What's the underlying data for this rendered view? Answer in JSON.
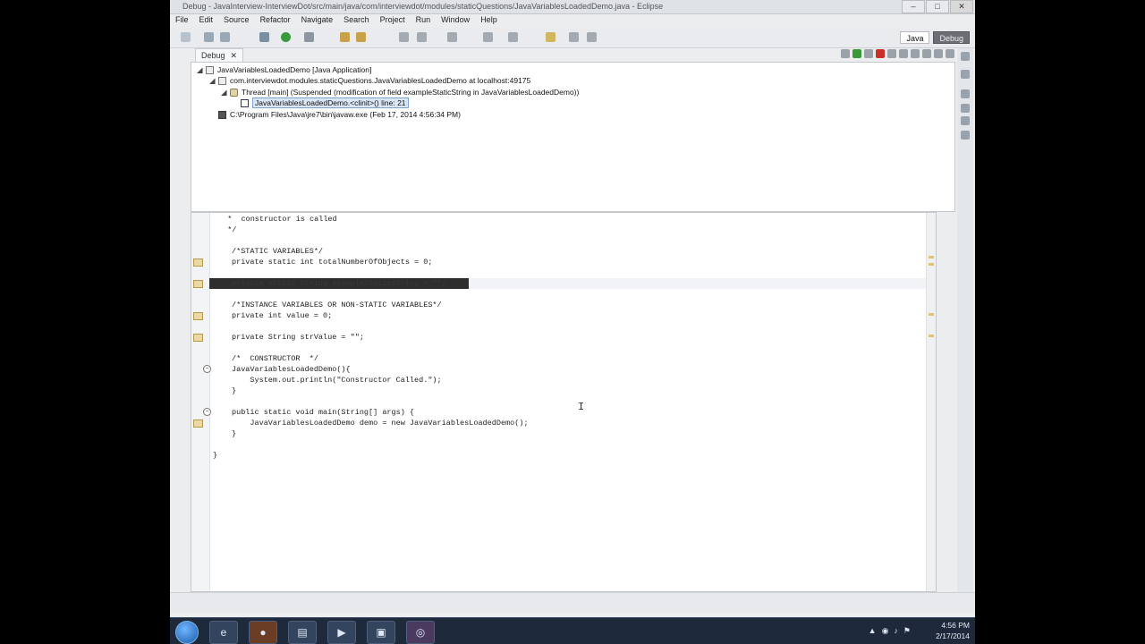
{
  "window": {
    "title": "Debug - JavaInterview-InterviewDot/src/main/java/com/interviewdot/modules/staticQuestions/JavaVariablesLoadedDemo.java - Eclipse",
    "controls": [
      "–",
      "□",
      "✕"
    ]
  },
  "menu": [
    "File",
    "Edit",
    "Source",
    "Refactor",
    "Navigate",
    "Search",
    "Project",
    "Run",
    "Window",
    "Help"
  ],
  "toolbar": {
    "perspective_java": "Java",
    "perspective_debug": "Debug"
  },
  "debug_view": {
    "tab_label": "Debug",
    "tab_close": "✕",
    "tree": [
      {
        "text": "JavaVariablesLoadedDemo [Java Application]",
        "icon": "app-launch-icon"
      },
      {
        "text": "com.interviewdot.modules.staticQuestions.JavaVariablesLoadedDemo at localhost:49175",
        "icon": "vm-icon"
      },
      {
        "text": "Thread [main] (Suspended (modification of field exampleStaticString in JavaVariablesLoadedDemo))",
        "icon": "thread-icon"
      },
      {
        "text": "JavaVariablesLoadedDemo.<clinit>() line: 21",
        "icon": "stack-frame-icon"
      },
      {
        "text": "C:\\Program Files\\Java\\jre7\\bin\\javaw.exe (Feb 17, 2014 4:56:34 PM)",
        "icon": "process-icon"
      }
    ]
  },
  "editor": {
    "lines": [
      {
        "text": "  *  constructor is called"
      },
      {
        "text": "  */"
      },
      {
        "text": ""
      },
      {
        "text": "/*STATIC VARIABLES*/"
      },
      {
        "text": "private static int totalNumberOfObjects = 0;"
      },
      {
        "text": ""
      },
      {
        "text": "private static String exampleStaticString = \"\";"
      },
      {
        "text": ""
      },
      {
        "text": "/*INSTANCE VARIABLES OR NON-STATIC VARIABLES*/"
      },
      {
        "text": "private int value = 0;"
      },
      {
        "text": ""
      },
      {
        "text": "private String strValue = \"\";"
      },
      {
        "text": ""
      },
      {
        "text": "/*  CONSTRUCTOR  */"
      },
      {
        "text": "JavaVariablesLoadedDemo(){"
      },
      {
        "text": "    System.out.println(\"Constructor Called.\");"
      },
      {
        "text": "}"
      },
      {
        "text": ""
      },
      {
        "text": "public static void main(String[] args) {"
      },
      {
        "text": "    JavaVariablesLoadedDemo demo = new JavaVariablesLoadedDemo();"
      },
      {
        "text": "}"
      },
      {
        "text": ""
      },
      {
        "text": "}"
      }
    ]
  },
  "taskbar": {
    "clock_time": "4:56 PM",
    "clock_date": "2/17/2014"
  },
  "colors": {
    "selection_fill": "#dbe6f4",
    "highlight_dark": "#2e2e2e",
    "taskbar": "#1e2a3c"
  }
}
